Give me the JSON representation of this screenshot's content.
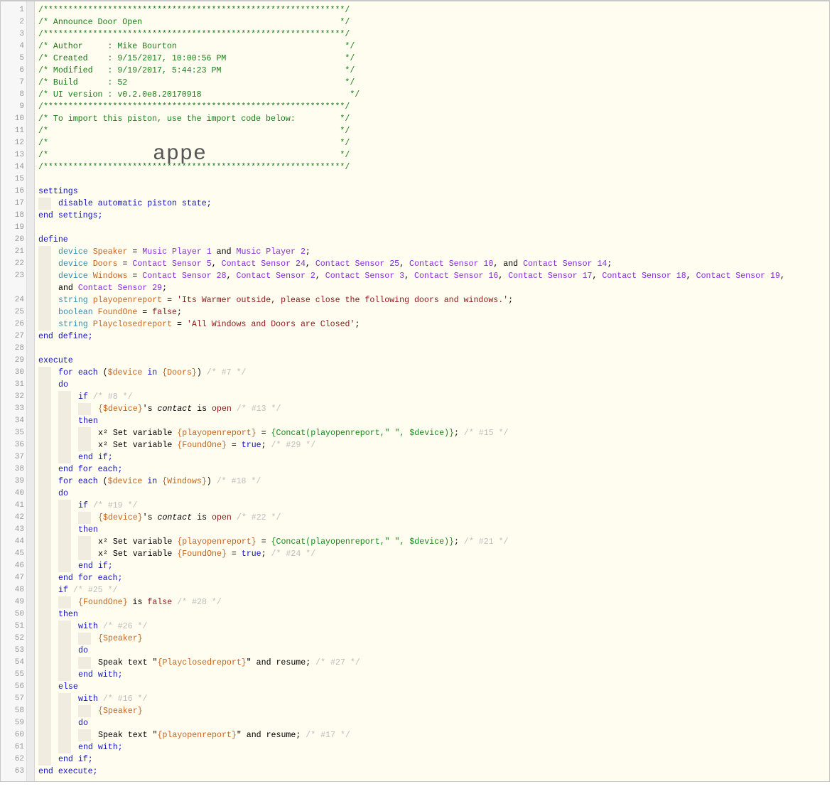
{
  "header_comment": {
    "border": "/*************************************************************/",
    "title": "/* Announce Door Open                                        */",
    "author": "/* Author     : Mike Bourton                                  */",
    "created": "/* Created    : 9/15/2017, 10:00:56 PM                        */",
    "modified": "/* Modified   : 9/19/2017, 5:44:23 PM                         */",
    "build": "/* Build      : 52                                            */",
    "ui_version": "/* UI version : v0.2.0e8.20170918                              */",
    "import_note": "/* To import this piston, use the import code below:         */",
    "blank": "/*                                                           */"
  },
  "overlay_text": "appe",
  "settings": {
    "open": "settings",
    "line": "disable automatic piston state;",
    "close": "end settings;"
  },
  "define": {
    "open": "define",
    "close": "end define;",
    "speaker": {
      "type": "device",
      "name": "Speaker",
      "values": [
        "Music Player 1",
        "and",
        "Music Player 2"
      ]
    },
    "doors": {
      "type": "device",
      "name": "Doors",
      "values": [
        "Contact Sensor 5",
        "Contact Sensor 24",
        "Contact Sensor 25",
        "Contact Sensor 10",
        "Contact Sensor 14"
      ]
    },
    "windows": {
      "type": "device",
      "name": "Windows",
      "values": [
        "Contact Sensor 28",
        "Contact Sensor 2",
        "Contact Sensor 3",
        "Contact Sensor 16",
        "Contact Sensor 17",
        "Contact Sensor 18",
        "Contact Sensor 19",
        "Contact Sensor 29"
      ]
    },
    "playopenreport": {
      "type": "string",
      "name": "playopenreport",
      "value": "'Its Warmer outside, please close the following doors and windows.'"
    },
    "foundone": {
      "type": "boolean",
      "name": "FoundOne",
      "value": "false"
    },
    "playclosedreport": {
      "type": "string",
      "name": "Playclosedreport",
      "value": "'All Windows and Doors are Closed'"
    }
  },
  "execute": {
    "open": "execute",
    "close": "end execute;",
    "loop1": {
      "collection": "{Doors}",
      "id": "/* #7 */",
      "if_id": "/* #8 */",
      "cond_id": "/* #13 */",
      "set1_id": "/* #15 */",
      "set2_id": "/* #29 */"
    },
    "loop2": {
      "collection": "{Windows}",
      "id": "/* #18 */",
      "if_id": "/* #19 */",
      "cond_id": "/* #22 */",
      "set1_id": "/* #21 */",
      "set2_id": "/* #24 */"
    },
    "final_if": {
      "id": "/* #25 */",
      "cond_id": "/* #28 */",
      "with1_id": "/* #26 */",
      "speak1_id": "/* #27 */",
      "with2_id": "/* #16 */",
      "speak2_id": "/* #17 */"
    }
  },
  "tokens": {
    "for_each": "for each",
    "device_var": "$device",
    "in": "in",
    "do": "do",
    "if": "if",
    "then": "then",
    "else": "else",
    "end_if": "end if;",
    "end_for_each": "end for each;",
    "with": "with",
    "end_with": "end with;",
    "device_ref": "{$device}",
    "apos_s": "'s ",
    "contact": "contact",
    "is": " is ",
    "open": "open",
    "false": "false",
    "true": "true",
    "x2": "x²",
    "set_variable": " Set variable ",
    "playopenreport_ref": "{playopenreport}",
    "foundone_ref": "{FoundOne}",
    "concat_expr": "{Concat(playopenreport,\" \", $device)}",
    "speaker_ref": "{Speaker}",
    "speak_text": "Speak text \"",
    "and_resume": "\" and resume;",
    "playclosedreport_ref": "{Playclosedreport}",
    "eq": " = ",
    "and": "and"
  }
}
